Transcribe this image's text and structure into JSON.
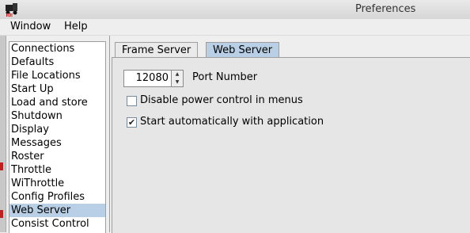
{
  "window": {
    "title": "Preferences",
    "icon": "jmri-train-icon"
  },
  "menu": [
    "Window",
    "Help"
  ],
  "sidebar": {
    "items": [
      "Connections",
      "Defaults",
      "File Locations",
      "Start Up",
      "Load and store",
      "Shutdown",
      "Display",
      "Messages",
      "Roster",
      "Throttle",
      "WiThrottle",
      "Config Profiles",
      "Web Server",
      "Consist Control"
    ],
    "selected": "Web Server"
  },
  "tabs": [
    {
      "label": "Frame Server",
      "active": false
    },
    {
      "label": "Web Server",
      "active": true
    }
  ],
  "web_server": {
    "port_value": "12080",
    "port_label": "Port Number",
    "disable_power_label": "Disable power control in menus",
    "disable_power_checked": false,
    "start_auto_label": "Start automatically with application",
    "start_auto_checked": true
  },
  "colors": {
    "selection": "#b8cfe5",
    "panel": "#e6e6e6"
  }
}
